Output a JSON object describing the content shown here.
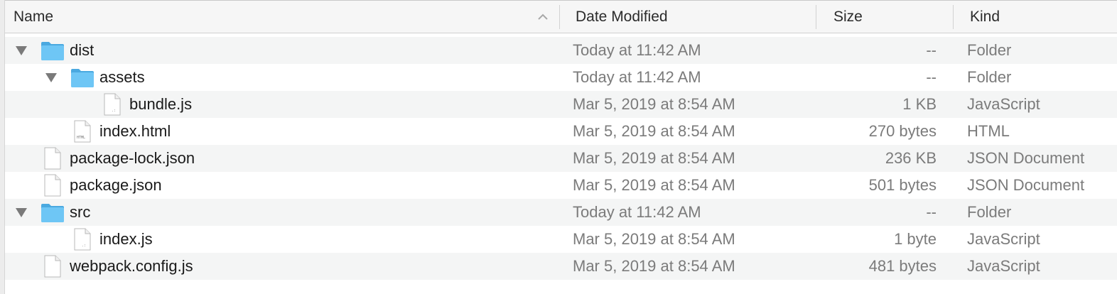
{
  "columns": {
    "name": "Name",
    "date": "Date Modified",
    "size": "Size",
    "kind": "Kind"
  },
  "rows": [
    {
      "name": "dist",
      "date": "Today at 11:42 AM",
      "size": "--",
      "kind": "Folder",
      "icon": "folder-icon",
      "level": 0,
      "expanded": true
    },
    {
      "name": "assets",
      "date": "Today at 11:42 AM",
      "size": "--",
      "kind": "Folder",
      "icon": "folder-icon",
      "level": 1,
      "expanded": true
    },
    {
      "name": "bundle.js",
      "date": "Mar 5, 2019 at 8:54 AM",
      "size": "1 KB",
      "kind": "JavaScript",
      "icon": "js-file-icon",
      "level": 2
    },
    {
      "name": "index.html",
      "date": "Mar 5, 2019 at 8:54 AM",
      "size": "270 bytes",
      "kind": "HTML",
      "icon": "html-file-icon",
      "level": 1
    },
    {
      "name": "package-lock.json",
      "date": "Mar 5, 2019 at 8:54 AM",
      "size": "236 KB",
      "kind": "JSON Document",
      "icon": "document-icon",
      "level": 0
    },
    {
      "name": "package.json",
      "date": "Mar 5, 2019 at 8:54 AM",
      "size": "501 bytes",
      "kind": "JSON Document",
      "icon": "document-icon",
      "level": 0
    },
    {
      "name": "src",
      "date": "Today at 11:42 AM",
      "size": "--",
      "kind": "Folder",
      "icon": "folder-icon",
      "level": 0,
      "expanded": true
    },
    {
      "name": "index.js",
      "date": "Mar 5, 2019 at 8:54 AM",
      "size": "1 byte",
      "kind": "JavaScript",
      "icon": "js-file-icon",
      "level": 1
    },
    {
      "name": "webpack.config.js",
      "date": "Mar 5, 2019 at 8:54 AM",
      "size": "481 bytes",
      "kind": "JavaScript",
      "icon": "document-icon",
      "level": 0
    }
  ],
  "colors": {
    "folder": "#6ec6f5",
    "folder_dark": "#4aa9e0",
    "alt_row": "#f4f5f5",
    "secondary_text": "#7b7b7b"
  }
}
